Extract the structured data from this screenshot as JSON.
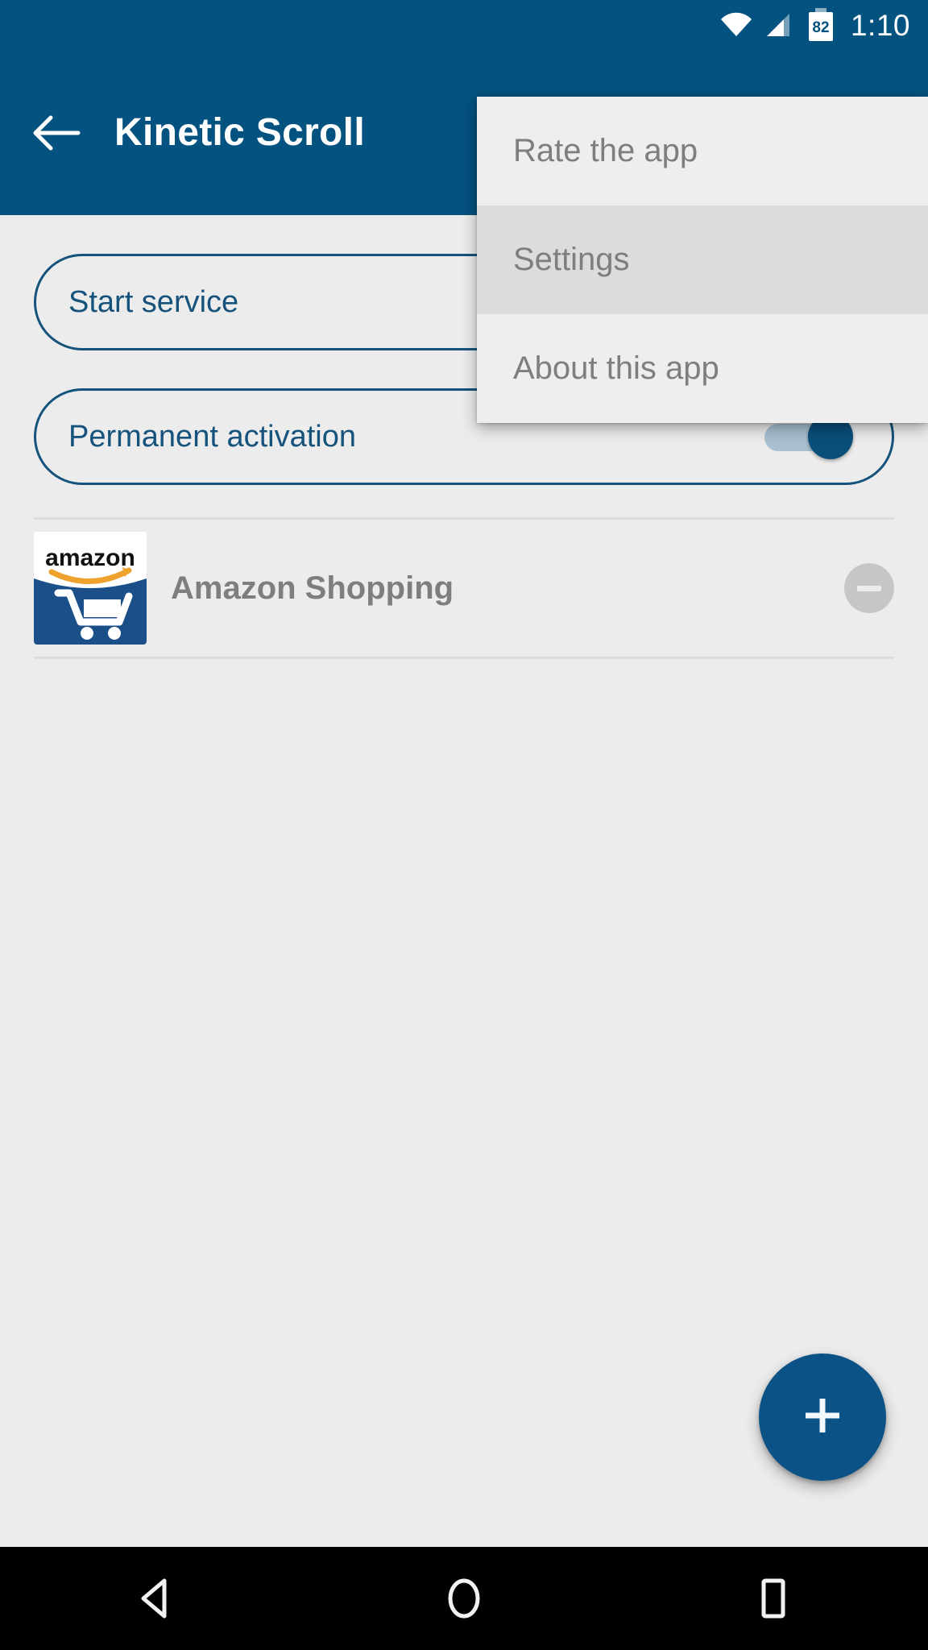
{
  "statusbar": {
    "wifi_icon": "wifi-icon",
    "signal_icon": "cell-signal-icon",
    "battery_icon": "battery-icon",
    "battery_level": "82",
    "time": "1:10"
  },
  "toolbar": {
    "back_icon": "back-arrow-icon",
    "title": "Kinetic Scroll",
    "background_color": "#04527F"
  },
  "overflow_menu": {
    "items": [
      {
        "label": "Rate the app",
        "pressed": false
      },
      {
        "label": "Settings",
        "pressed": true
      },
      {
        "label": "About this app",
        "pressed": false
      }
    ],
    "background_color": "#EEEEEE",
    "pressed_color": "#DCDCDC",
    "text_color": "#7E7E7E"
  },
  "main": {
    "start_service": {
      "label": "Start service",
      "outline_color": "#16537C"
    },
    "permanent_activation": {
      "label": "Permanent activation",
      "outline_color": "#16537C",
      "toggle_state": "on",
      "toggle_thumb_color": "#0A4F7A",
      "toggle_track_color": "#A9C0D1"
    },
    "app_list": [
      {
        "name": "Amazon Shopping",
        "icon": "amazon-app-icon",
        "icon_wordmark": "amazon",
        "remove_icon": "minus-circle-icon"
      }
    ],
    "fab": {
      "icon": "plus-icon",
      "color": "#0B5286"
    },
    "background_color": "#ECECEC"
  },
  "navbar": {
    "back_icon": "nav-back-triangle-icon",
    "home_icon": "nav-home-circle-icon",
    "recents_icon": "nav-recents-square-icon",
    "background_color": "#000000"
  }
}
